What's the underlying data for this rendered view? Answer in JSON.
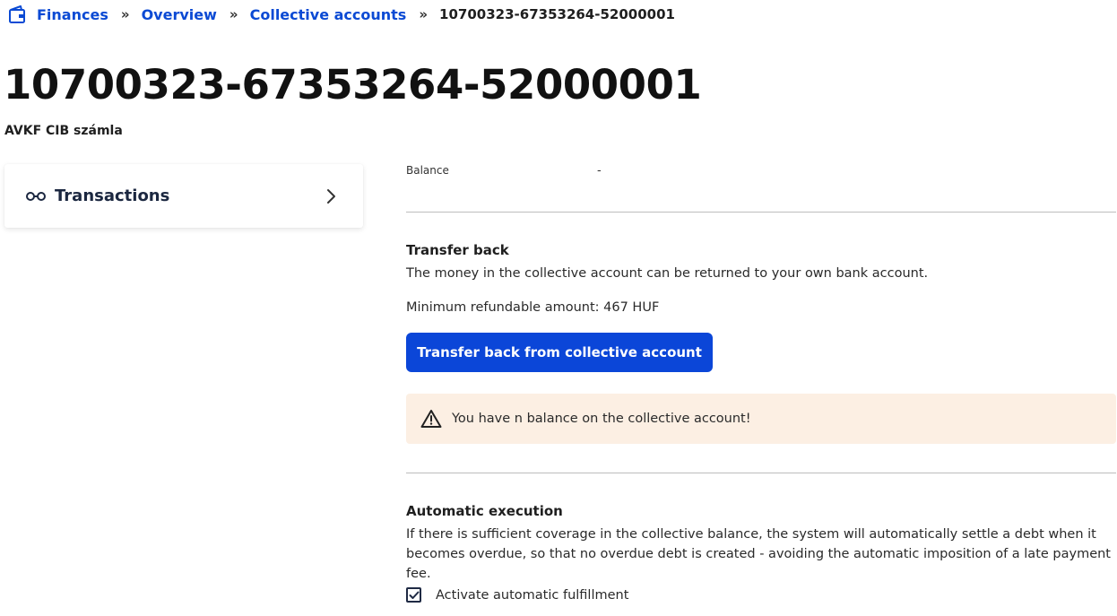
{
  "breadcrumb": {
    "home_icon": "wallet-icon",
    "items": [
      "Finances",
      "Overview",
      "Collective accounts"
    ],
    "separator": "»",
    "current": "10700323-67353264-52000001"
  },
  "header": {
    "title": "10700323-67353264-52000001",
    "subtitle": "AVKF CIB számla"
  },
  "sidebar": {
    "transactions": {
      "icon": "glasses-icon",
      "label": "Transactions",
      "chevron": "chevron-right-icon"
    }
  },
  "balance": {
    "label": "Balance",
    "value": "-"
  },
  "transfer_back": {
    "title": "Transfer back",
    "description": "The money in the collective account can be returned to your own bank account.",
    "minimum": "Minimum refundable amount: 467 HUF",
    "button_label": "Transfer back from collective account"
  },
  "alert": {
    "icon": "warning-icon",
    "text": "You have n balance on the collective account!",
    "background": "#fcefe3"
  },
  "automatic": {
    "title": "Automatic execution",
    "description_line1": "If there is sufficient coverage in the collective balance, the system will automatically settle a debt when it",
    "description_line2": "becomes overdue, so that no overdue debt is created - avoiding the automatic imposition of a late payment fee.",
    "checkbox_label": "Activate automatic fulfillment",
    "checkbox_checked": true
  },
  "colors": {
    "accent": "#0b46d8",
    "link": "#0b4ad4"
  }
}
